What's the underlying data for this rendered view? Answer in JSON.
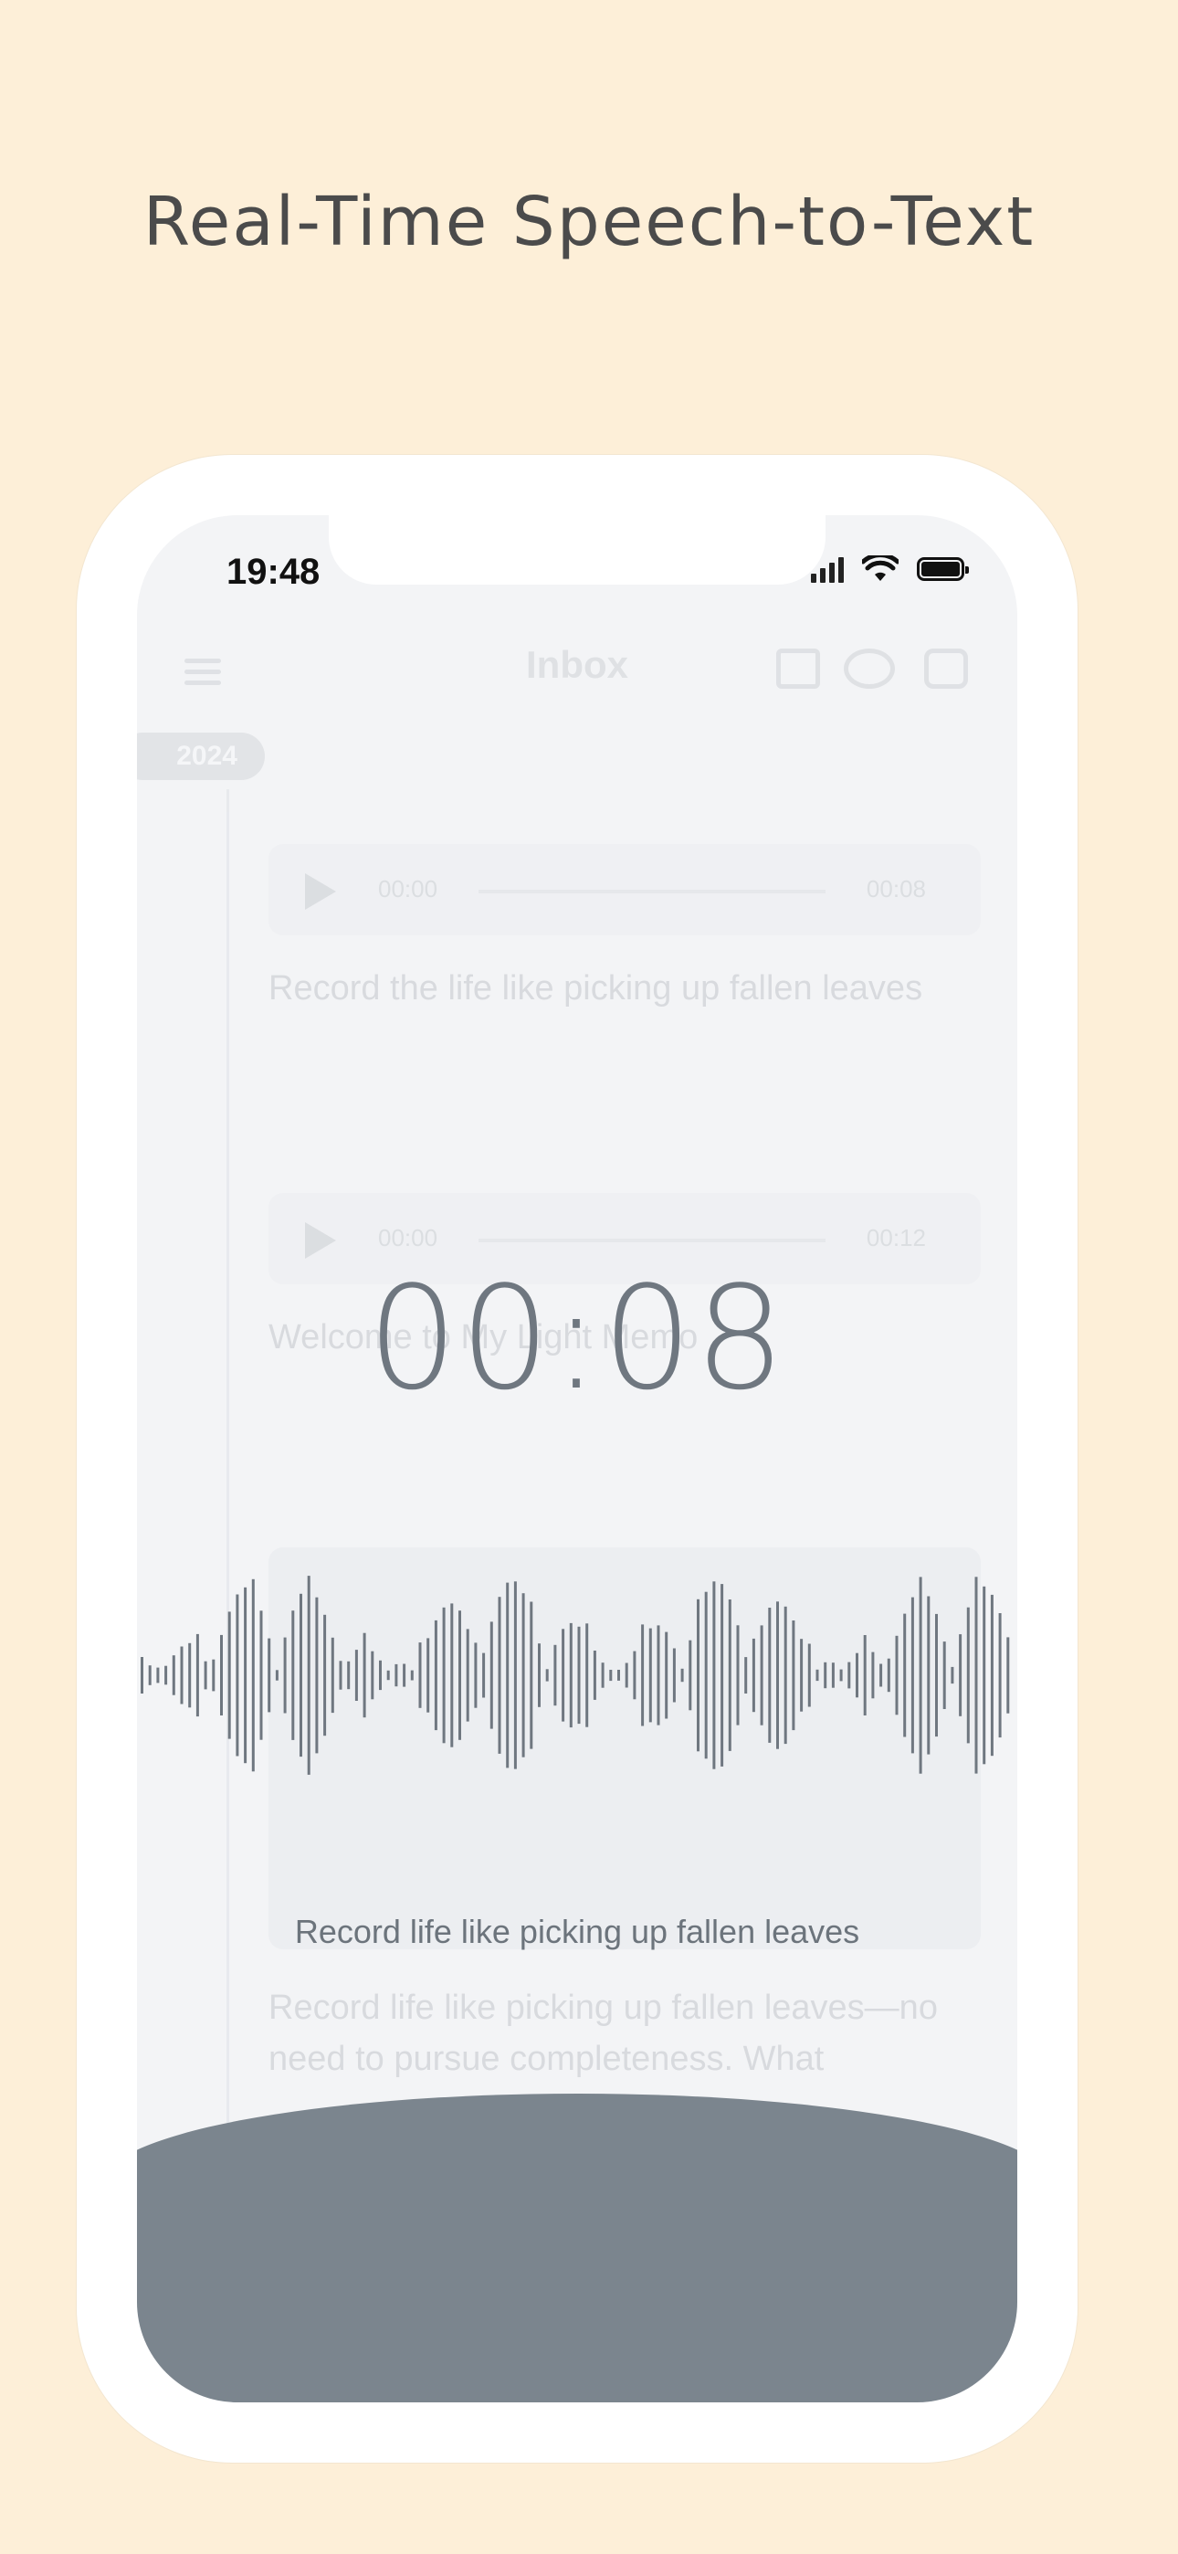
{
  "headline": "Real-Time Speech-to-Text",
  "status_bar": {
    "time": "19:48"
  },
  "background_app": {
    "title": "Inbox",
    "year_badge": "2024",
    "entries": [
      {
        "player_start": "00:00",
        "player_end": "00:08",
        "text": "Record the life like picking up fallen leaves"
      },
      {
        "player_start": "00:00",
        "player_end": "00:12",
        "text": "Welcome to My Light Memo"
      },
      {
        "text": "Record life like picking up fallen leaves—no need to pursue completeness. What"
      }
    ]
  },
  "recording": {
    "timer": "00:08",
    "transcript": "Record life like picking up fallen leaves"
  },
  "colors": {
    "page_background": "#fdefd8",
    "waveform": "#6f7780",
    "record_panel": "#7b858e"
  }
}
